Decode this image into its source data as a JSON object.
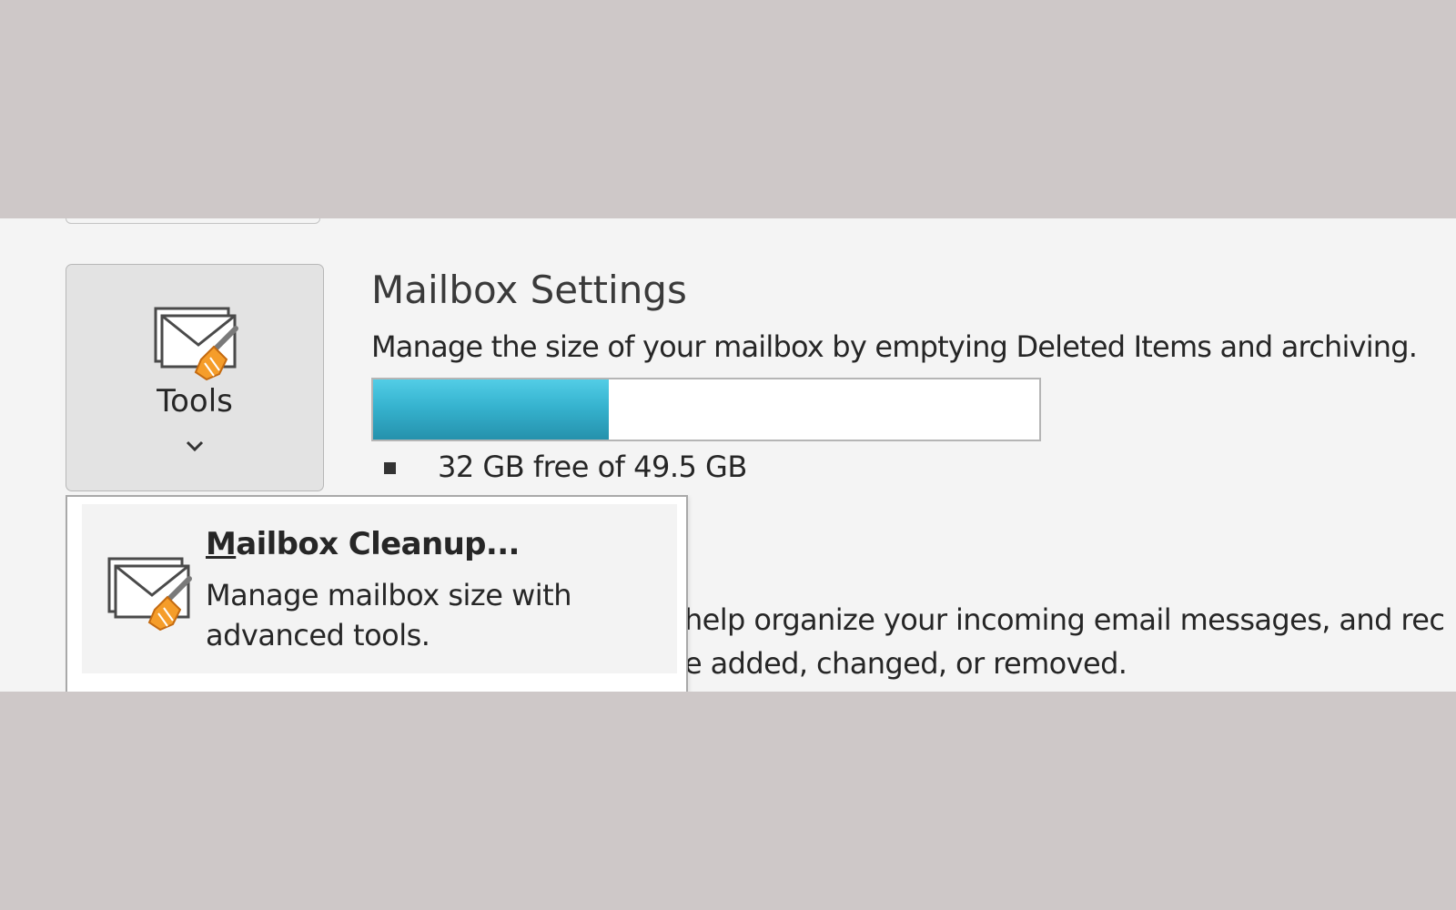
{
  "tools_button": {
    "label": "Tools",
    "icon": "mail-broom-icon",
    "chevron_icon": "chevron-down-icon"
  },
  "mailbox_settings": {
    "title": "Mailbox Settings",
    "description": "Manage the size of your mailbox by emptying Deleted Items and archiving.",
    "usage_text": "32 GB free of 49.5 GB",
    "used_fraction": 0.354,
    "bar_color": "#36b3cf"
  },
  "background_text": {
    "line1": "help organize your incoming email messages, and rec",
    "line2": "e added, changed, or removed."
  },
  "dropdown_menu": {
    "items": [
      {
        "title_accel": "M",
        "title_rest": "ailbox Cleanup...",
        "description": "Manage mailbox size with advanced tools.",
        "icon": "mail-broom-icon"
      }
    ]
  }
}
